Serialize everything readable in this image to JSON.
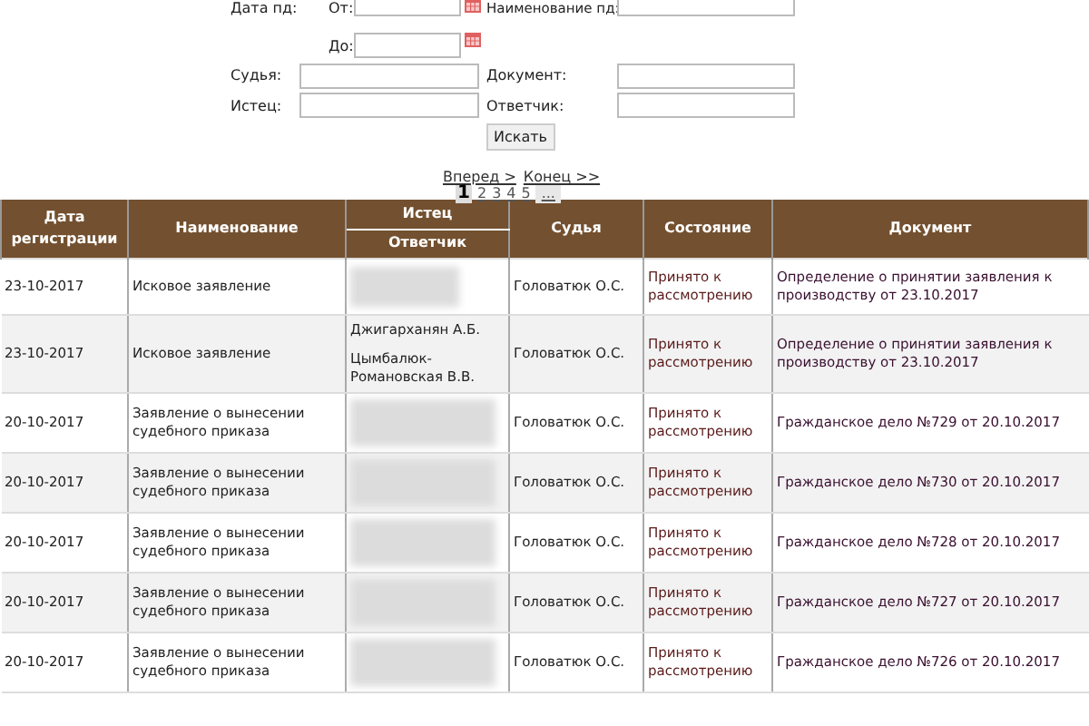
{
  "filter": {
    "date_label": "Дата пд:",
    "from_label": "От:",
    "to_label": "До:",
    "name_label": "Наименование пд:",
    "judge_label": "Судья:",
    "document_label": "Документ:",
    "plaintiff_label": "Истец:",
    "defendant_label": "Ответчик:",
    "search_button": "Искать"
  },
  "pagination": {
    "next": "Вперед >",
    "last": "Конец >>",
    "pages": [
      {
        "label": "1",
        "selected": true
      },
      {
        "label": "2",
        "selected": false
      },
      {
        "label": "3",
        "selected": false
      },
      {
        "label": "4",
        "selected": false
      },
      {
        "label": "5",
        "selected": false
      },
      {
        "label": "...",
        "selected": false
      }
    ]
  },
  "table": {
    "columns": [
      "Дата регистрации",
      "Наименование",
      "Истец",
      "Ответчик",
      "Судья",
      "Состояние",
      "Документ"
    ],
    "rows": [
      {
        "date": "23-10-2017",
        "name": "Исковое заявление",
        "parties": {
          "kind": "redacted"
        },
        "judge": "Головатюк О.С.",
        "state": "Принято к рассмотрению",
        "document": "Определение о принятии заявления к производству от 23.10.2017"
      },
      {
        "date": "23-10-2017",
        "name": "Исковое заявление",
        "parties": {
          "kind": "named",
          "plaintiff": "Джигарханян А.Б.",
          "defendant": "Цымбалюк-Романовская В.В."
        },
        "judge": "Головатюк О.С.",
        "state": "Принято к рассмотрению",
        "document": "Определение о принятии заявления к производству от 23.10.2017"
      },
      {
        "date": "20-10-2017",
        "name": "Заявление о вынесении судебного приказа",
        "parties": {
          "kind": "redacted"
        },
        "judge": "Головатюк О.С.",
        "state": "Принято к рассмотрению",
        "document": "Гражданское дело №729 от 20.10.2017"
      },
      {
        "date": "20-10-2017",
        "name": "Заявление о вынесении судебного приказа",
        "parties": {
          "kind": "redacted"
        },
        "judge": "Головатюк О.С.",
        "state": "Принято к рассмотрению",
        "document": "Гражданское дело №730 от 20.10.2017"
      },
      {
        "date": "20-10-2017",
        "name": "Заявление о вынесении судебного приказа",
        "parties": {
          "kind": "redacted"
        },
        "judge": "Головатюк О.С.",
        "state": "Принято к рассмотрению",
        "document": "Гражданское дело №728 от 20.10.2017"
      },
      {
        "date": "20-10-2017",
        "name": "Заявление о вынесении судебного приказа",
        "parties": {
          "kind": "redacted"
        },
        "judge": "Головатюк О.С.",
        "state": "Принято к рассмотрению",
        "document": "Гражданское дело №727 от 20.10.2017"
      },
      {
        "date": "20-10-2017",
        "name": "Заявление о вынесении судебного приказа",
        "parties": {
          "kind": "redacted"
        },
        "judge": "Головатюк О.С.",
        "state": "Принято к рассмотрению",
        "document": "Гражданское дело №726 от 20.10.2017"
      }
    ]
  }
}
